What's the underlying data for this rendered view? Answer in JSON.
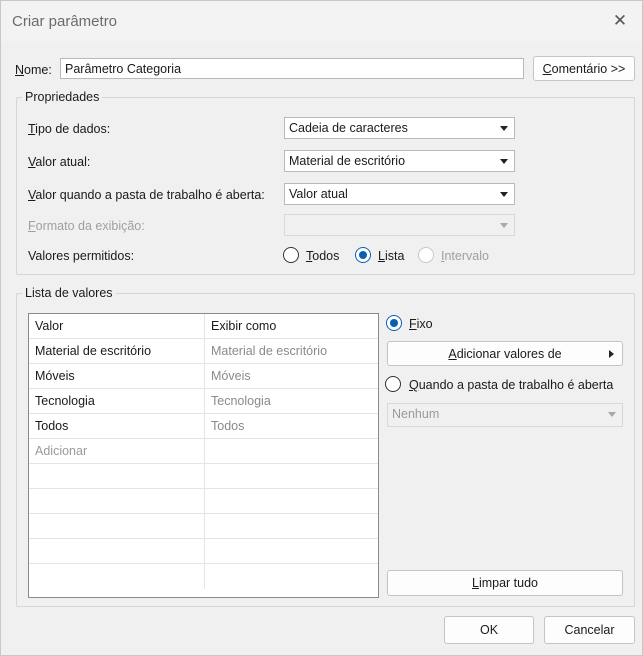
{
  "window": {
    "title": "Criar parâmetro",
    "close_icon": "close-icon"
  },
  "name": {
    "label": "Nome:",
    "value": "Parâmetro Categoria",
    "comment_button": "Comentário >>"
  },
  "properties": {
    "group_title": "Propriedades",
    "data_type": {
      "label": "Tipo de dados:",
      "value": "Cadeia de caracteres"
    },
    "current_value": {
      "label": "Valor atual:",
      "value": "Material de escritório"
    },
    "open_value": {
      "label": "Valor quando a pasta de trabalho é aberta:",
      "value": "Valor atual"
    },
    "display_format": {
      "label": "Formato da exibição:",
      "value": ""
    },
    "allowed_values": {
      "label": "Valores permitidos:",
      "options": [
        {
          "label": "Todos",
          "checked": false,
          "disabled": false
        },
        {
          "label": "Lista",
          "checked": true,
          "disabled": false
        },
        {
          "label": "Intervalo",
          "checked": false,
          "disabled": true
        }
      ]
    }
  },
  "value_list": {
    "group_title": "Lista de valores",
    "columns": [
      "Valor",
      "Exibir como"
    ],
    "rows": [
      {
        "value": "Material de escritório",
        "display": "Material de escritório"
      },
      {
        "value": "Móveis",
        "display": "Móveis"
      },
      {
        "value": "Tecnologia",
        "display": "Tecnologia"
      },
      {
        "value": "Todos",
        "display": "Todos"
      }
    ],
    "add_placeholder": "Adicionar",
    "fixed_label": "Fixo",
    "add_values_button": "Adicionar valores de",
    "when_open_label": "Quando a pasta de trabalho é aberta",
    "source_combo": "Nenhum",
    "clear_button": "Limpar tudo"
  },
  "footer": {
    "ok": "OK",
    "cancel": "Cancelar"
  },
  "colors": {
    "accent": "#0a5fb5",
    "background": "#f0f0f0"
  }
}
